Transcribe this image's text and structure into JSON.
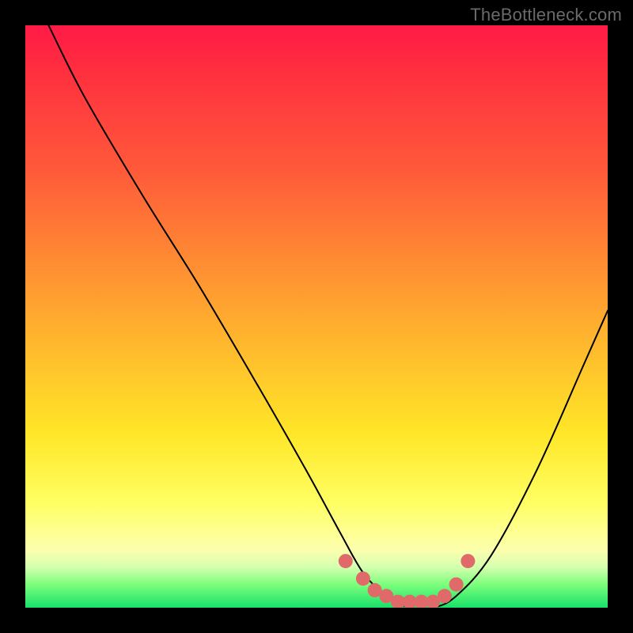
{
  "watermark": "TheBottleneck.com",
  "chart_data": {
    "type": "line",
    "title": "",
    "xlabel": "",
    "ylabel": "",
    "xlim": [
      0,
      100
    ],
    "ylim": [
      0,
      100
    ],
    "series": [
      {
        "name": "bottleneck-curve",
        "x": [
          4,
          10,
          20,
          30,
          40,
          48,
          54,
          58,
          62,
          66,
          70,
          74,
          80,
          88,
          96,
          100
        ],
        "y": [
          100,
          88,
          71,
          55,
          38,
          24,
          13,
          6,
          2,
          0,
          0,
          2,
          9,
          24,
          42,
          51
        ]
      }
    ],
    "markers": {
      "name": "trough-markers",
      "color": "#e06a6a",
      "points": [
        {
          "x": 55,
          "y": 8
        },
        {
          "x": 58,
          "y": 5
        },
        {
          "x": 60,
          "y": 3
        },
        {
          "x": 62,
          "y": 2
        },
        {
          "x": 64,
          "y": 1
        },
        {
          "x": 66,
          "y": 1
        },
        {
          "x": 68,
          "y": 1
        },
        {
          "x": 70,
          "y": 1
        },
        {
          "x": 72,
          "y": 2
        },
        {
          "x": 74,
          "y": 4
        },
        {
          "x": 76,
          "y": 8
        }
      ]
    }
  }
}
